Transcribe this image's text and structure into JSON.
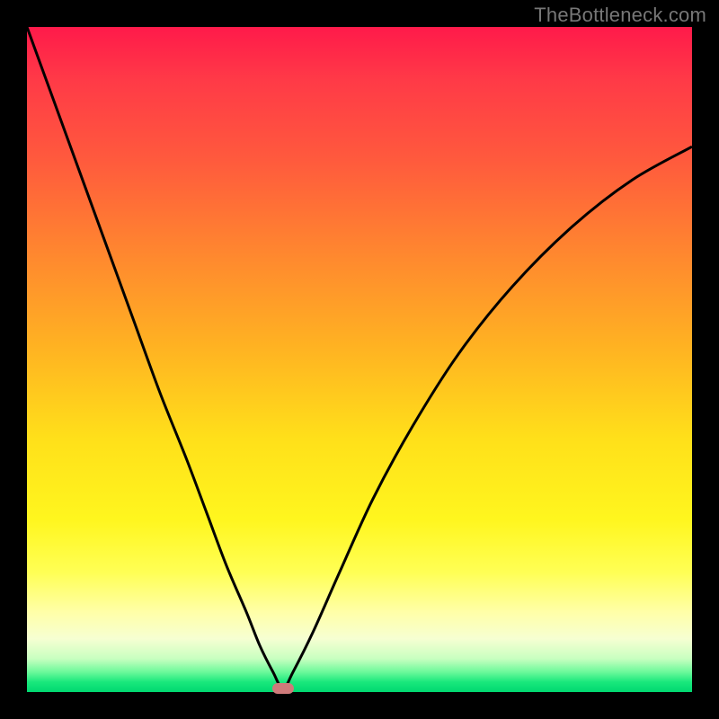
{
  "watermark": "TheBottleneck.com",
  "chart_data": {
    "type": "line",
    "title": "",
    "xlabel": "",
    "ylabel": "",
    "xlim": [
      0,
      100
    ],
    "ylim": [
      0,
      100
    ],
    "grid": false,
    "marker": {
      "x": 38.5,
      "y": 0.5,
      "color": "#cf7a7a"
    },
    "gradient_stops": [
      {
        "pos": 0,
        "color": "#ff1a4a"
      },
      {
        "pos": 0.35,
        "color": "#ff8a2e"
      },
      {
        "pos": 0.62,
        "color": "#ffe01a"
      },
      {
        "pos": 0.88,
        "color": "#ffffa8"
      },
      {
        "pos": 1.0,
        "color": "#00d870"
      }
    ],
    "series": [
      {
        "name": "bottleneck-curve",
        "x": [
          0,
          4,
          8,
          12,
          16,
          20,
          24,
          27,
          30,
          33,
          35,
          37,
          38.5,
          40,
          43,
          47,
          52,
          58,
          65,
          73,
          82,
          91,
          100
        ],
        "y": [
          100,
          89,
          78,
          67,
          56,
          45,
          35,
          27,
          19,
          12,
          7,
          3,
          0.5,
          3,
          9,
          18,
          29,
          40,
          51,
          61,
          70,
          77,
          82
        ]
      }
    ]
  }
}
